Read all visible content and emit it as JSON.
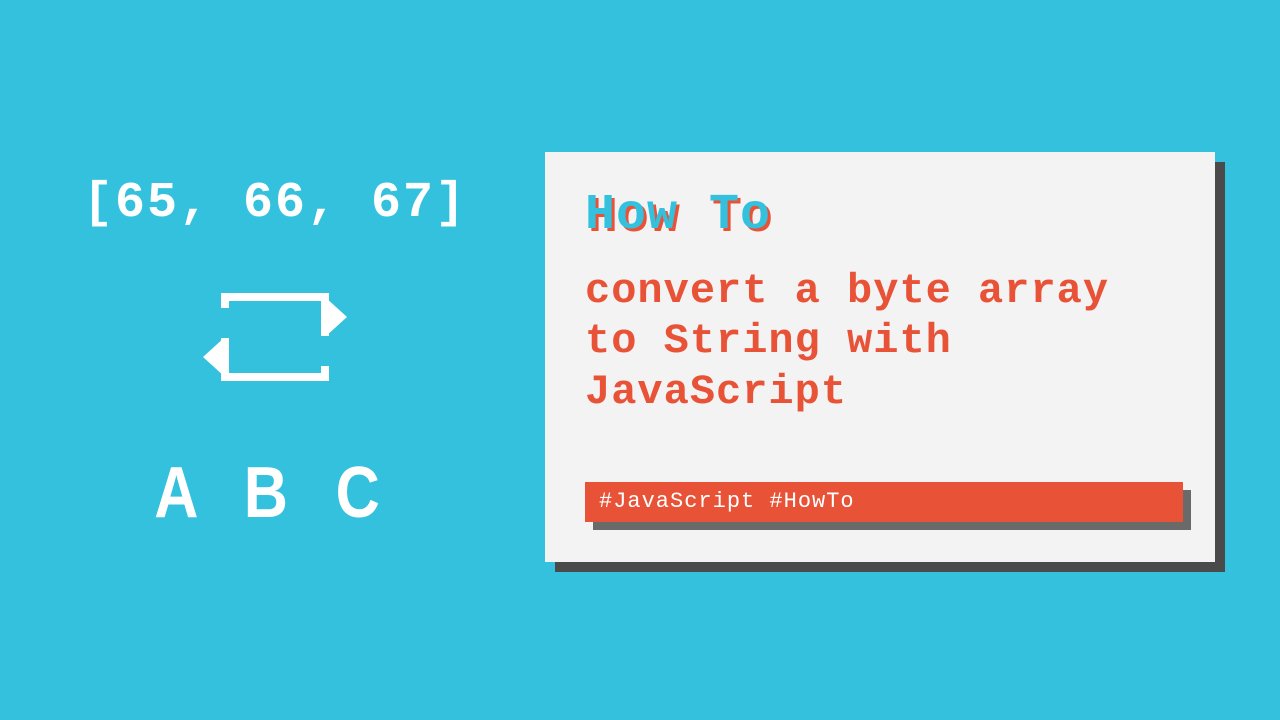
{
  "colors": {
    "background": "#33c1de",
    "accent": "#e85338",
    "card": "#f3f3f3",
    "shadow": "#4a4a4a"
  },
  "left": {
    "byte_array": "[65, 66, 67]",
    "output_letters": "A B C"
  },
  "card": {
    "kicker": "How To",
    "title": "convert a byte array to String with JavaScript",
    "tags_text": "#JavaScript  #HowTo",
    "tags": [
      "#JavaScript",
      "#HowTo"
    ]
  }
}
